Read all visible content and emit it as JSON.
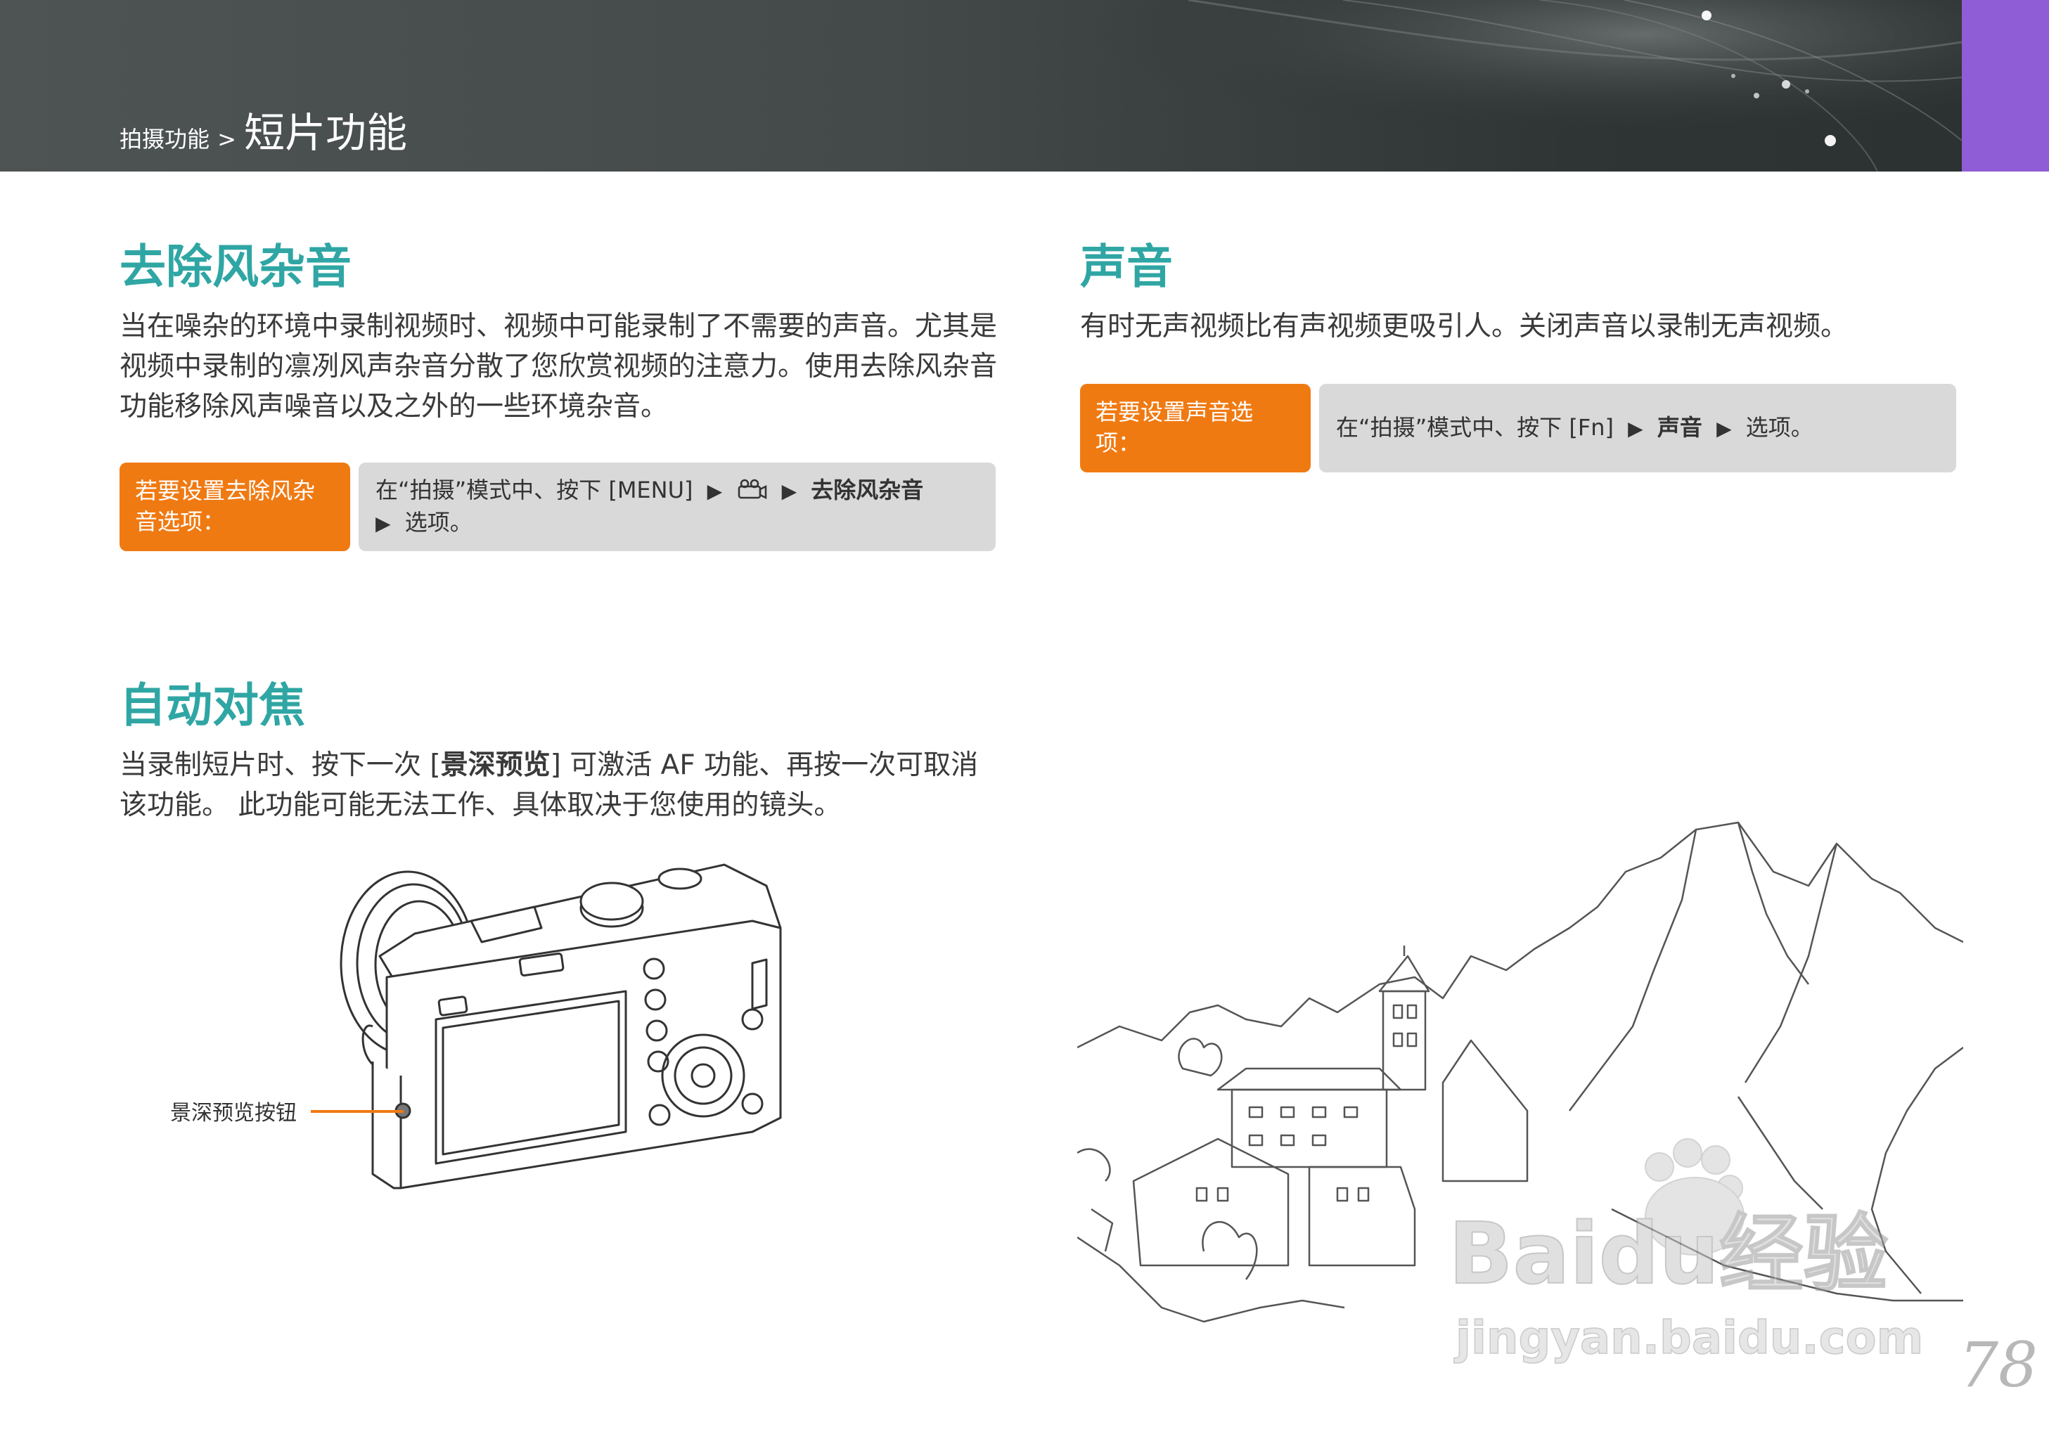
{
  "header": {
    "breadcrumb_parent": "拍摄功能",
    "breadcrumb_separator": ">",
    "breadcrumb_current": "短片功能",
    "accent_color": "#8f5dd6"
  },
  "wind_cut": {
    "title": "去除风杂音",
    "description": "当在噪杂的环境中录制视频时、视频中可能录制了不需要的声音。尤其是视频中录制的凛冽风声杂音分散了您欣赏视频的注意力。使用去除风杂音功能移除风声噪音以及之外的一些环境杂音。",
    "callout_label": "若要设置去除风杂音选项：",
    "callout_text_1": "在“拍摄”模式中、按下 [MENU]",
    "callout_arrow": "▶",
    "callout_movie_icon": "movie-settings-icon",
    "callout_bold": "去除风杂音",
    "callout_text_2": "选项。"
  },
  "sound": {
    "title": "声音",
    "description": "有时无声视频比有声视频更吸引人。关闭声音以录制无声视频。",
    "callout_label": "若要设置声音选项：",
    "callout_text_1": "在“拍摄”模式中、按下 [Fn]",
    "callout_arrow": "▶",
    "callout_bold": "声音",
    "callout_text_2": "选项。"
  },
  "af": {
    "title": "自动对焦",
    "description_before": "当录制短片时、按下一次 [",
    "description_bold": "景深预览",
    "description_after": "] 可激活 AF 功能、再按一次可取消该功能。 此功能可能无法工作、具体取决于您使用的镜头。",
    "figure_label": "景深预览按钮"
  },
  "watermark": {
    "brand": "Baidu经验",
    "url": "jingyan.baidu.com"
  },
  "page_number": "78",
  "colors": {
    "title_teal": "#2fa6a4",
    "callout_orange": "#f07a12",
    "callout_gray": "#d9d9d9"
  }
}
